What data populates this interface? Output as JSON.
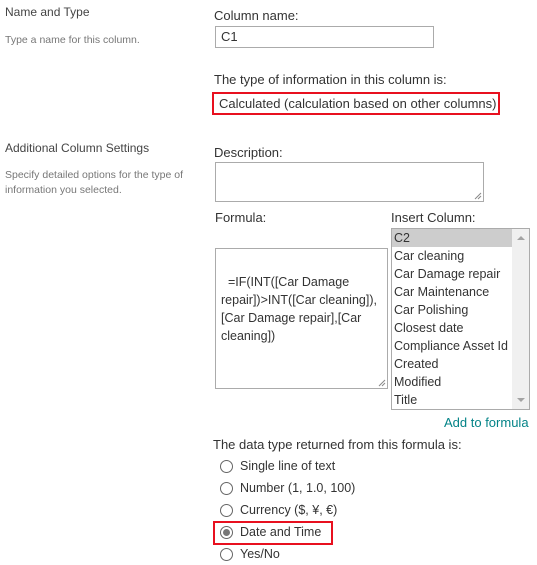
{
  "name_and_type": {
    "title": "Name and Type",
    "description": "Type a name for this column.",
    "column_name_label": "Column name:",
    "column_name_value": "C1",
    "type_label": "The type of information in this column is:",
    "type_value": "Calculated (calculation based on other columns)"
  },
  "additional_settings": {
    "title": "Additional Column Settings",
    "description": "Specify detailed options for the type of information you selected.",
    "description_label": "Description:",
    "description_value": "",
    "formula_label": "Formula:",
    "formula_value": "=IF(INT([Car Damage repair])>INT([Car cleaning]),[Car Damage repair],[Car cleaning])",
    "insert_column_label": "Insert Column:",
    "insert_columns": [
      {
        "label": "C2",
        "selected": true
      },
      {
        "label": "Car cleaning",
        "selected": false
      },
      {
        "label": "Car Damage repair",
        "selected": false
      },
      {
        "label": "Car Maintenance",
        "selected": false
      },
      {
        "label": "Car Polishing",
        "selected": false
      },
      {
        "label": "Closest date",
        "selected": false
      },
      {
        "label": "Compliance Asset Id",
        "selected": false
      },
      {
        "label": "Created",
        "selected": false
      },
      {
        "label": "Modified",
        "selected": false
      },
      {
        "label": "Title",
        "selected": false
      }
    ],
    "add_to_formula_label": "Add to formula",
    "return_type_label": "The data type returned from this formula is:",
    "return_types": [
      {
        "label": "Single line of text",
        "checked": false
      },
      {
        "label": "Number (1, 1.0, 100)",
        "checked": false
      },
      {
        "label": "Currency ($, ¥, €)",
        "checked": false
      },
      {
        "label": "Date and Time",
        "checked": true
      },
      {
        "label": "Yes/No",
        "checked": false
      }
    ]
  },
  "colors": {
    "highlight": "#e8101f",
    "link": "#038387",
    "selected_item_bg": "#cdcdcd"
  }
}
